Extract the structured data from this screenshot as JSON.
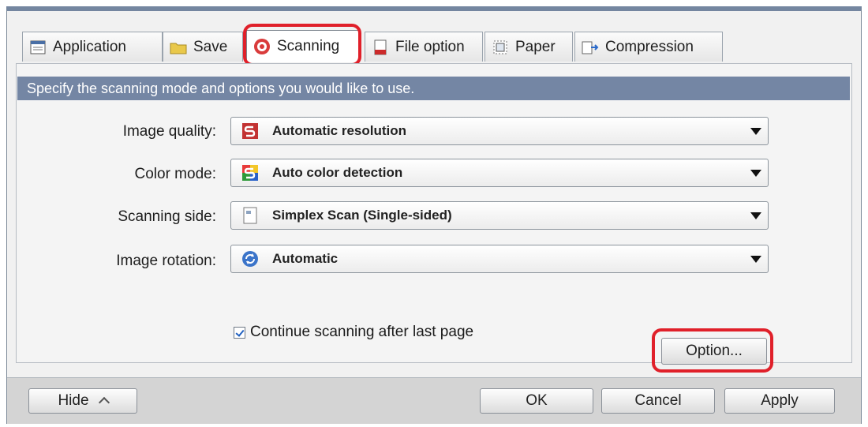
{
  "tabs": [
    {
      "label": "Application",
      "icon": "application-icon"
    },
    {
      "label": "Save",
      "icon": "folder-icon"
    },
    {
      "label": "Scanning",
      "icon": "scan-icon",
      "active": true
    },
    {
      "label": "File option",
      "icon": "file-icon"
    },
    {
      "label": "Paper",
      "icon": "paper-icon"
    },
    {
      "label": "Compression",
      "icon": "compression-icon"
    }
  ],
  "header": {
    "text": "Specify the scanning mode and options you would like to use."
  },
  "fields": [
    {
      "label": "Image quality:",
      "value": "Automatic resolution",
      "icon": "resolution-icon"
    },
    {
      "label": "Color mode:",
      "value": "Auto color detection",
      "icon": "color-icon"
    },
    {
      "label": "Scanning side:",
      "value": "Simplex Scan (Single-sided)",
      "icon": "page-icon"
    },
    {
      "label": "Image rotation:",
      "value": "Automatic",
      "icon": "rotation-icon"
    }
  ],
  "checkbox": {
    "label": "Continue scanning after last page",
    "checked": true
  },
  "buttons": {
    "option": "Option...",
    "hide": "Hide",
    "ok": "OK",
    "cancel": "Cancel",
    "apply": "Apply"
  },
  "colors": {
    "highlight": "#e0202a",
    "header_bg": "#7486a4"
  }
}
